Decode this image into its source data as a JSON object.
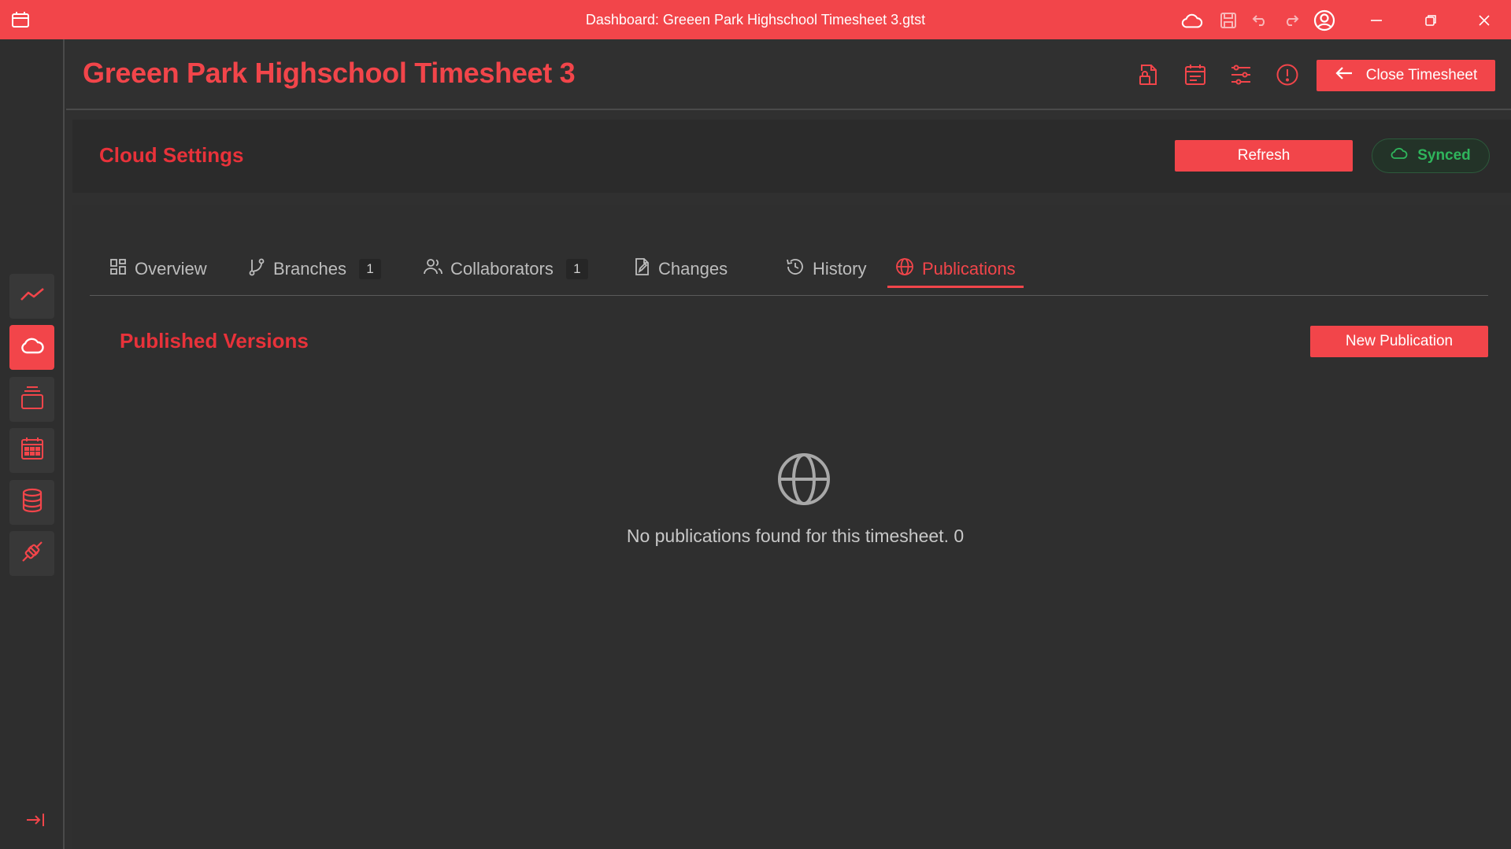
{
  "window": {
    "title": "Dashboard: Greeen Park Highschool Timesheet 3.gtst"
  },
  "header": {
    "title": "Greeen Park Highschool Timesheet 3",
    "close_label": "Close Timesheet"
  },
  "cloud": {
    "title": "Cloud Settings",
    "refresh_label": "Refresh",
    "status_label": "Synced"
  },
  "tabs": [
    {
      "label": "Overview",
      "icon": "grid-icon"
    },
    {
      "label": "Branches",
      "icon": "branch-icon",
      "count": "1"
    },
    {
      "label": "Collaborators",
      "icon": "users-icon",
      "count": "1"
    },
    {
      "label": "Changes",
      "icon": "file-edit-icon"
    },
    {
      "label": "History",
      "icon": "history-icon"
    },
    {
      "label": "Publications",
      "icon": "globe-icon",
      "active": true
    }
  ],
  "publications": {
    "section_title": "Published Versions",
    "new_label": "New Publication",
    "empty_message": "No publications found for this timesheet. 0"
  },
  "sidebar": {
    "items": [
      {
        "icon": "trend-icon"
      },
      {
        "icon": "cloud-icon",
        "active": true
      },
      {
        "icon": "layers-icon"
      },
      {
        "icon": "calendar-icon"
      },
      {
        "icon": "database-icon"
      },
      {
        "icon": "plug-icon"
      }
    ]
  },
  "colors": {
    "accent": "#f2454a",
    "background": "#303030",
    "synced": "#2fb55c"
  }
}
